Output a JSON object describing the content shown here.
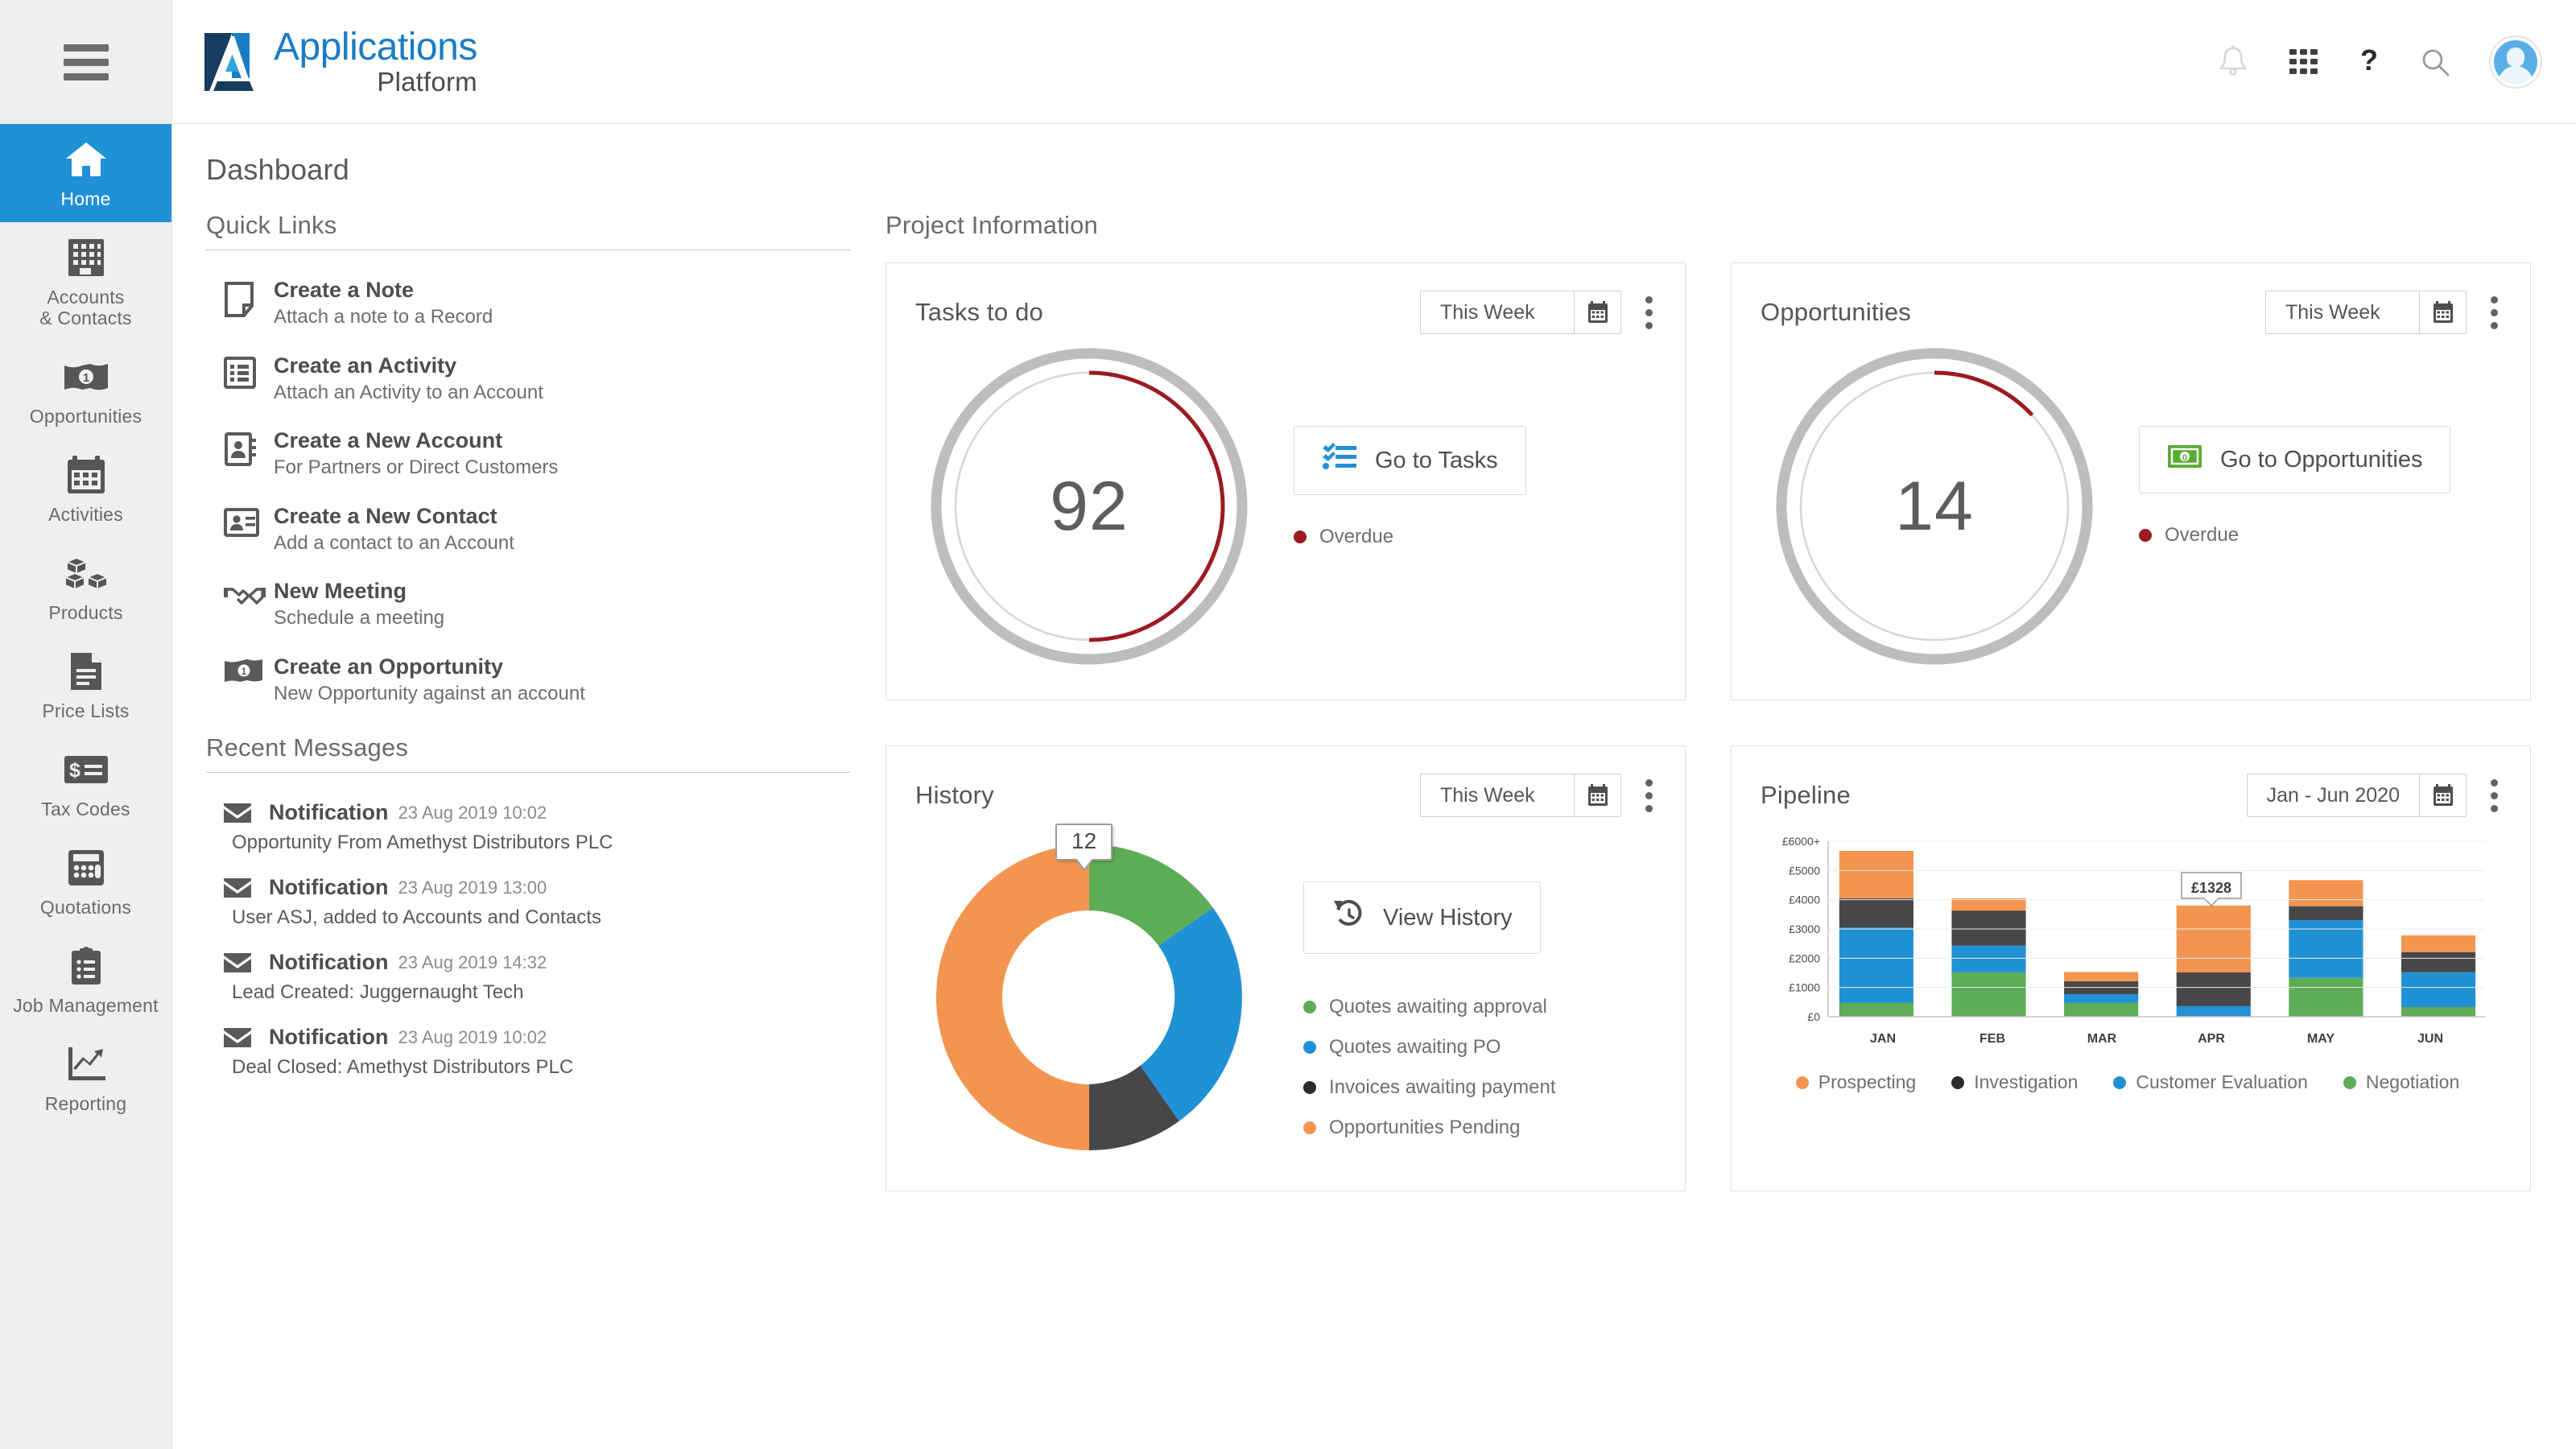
{
  "brand": {
    "line1": "Applications",
    "line2": "Platform",
    "logo_icon": "applications-platform-logo"
  },
  "header": {
    "icons": [
      {
        "name": "notifications-bell-icon",
        "label": "Notifications"
      },
      {
        "name": "app-grid-icon",
        "label": "Apps"
      },
      {
        "name": "help-question-icon",
        "label": "Help"
      },
      {
        "name": "search-icon",
        "label": "Search"
      }
    ],
    "avatar_label": "User profile"
  },
  "sidebar": {
    "menu_icon": "hamburger-menu-icon",
    "items": [
      {
        "label": "Home",
        "icon": "home-icon",
        "active": true
      },
      {
        "label": "Accounts\n& Contacts",
        "label_line1": "Accounts",
        "label_line2": "& Contacts",
        "icon": "building-icon",
        "active": false
      },
      {
        "label": "Opportunities",
        "icon": "banknote-icon",
        "active": false
      },
      {
        "label": "Activities",
        "icon": "calendar-icon",
        "active": false
      },
      {
        "label": "Products",
        "icon": "boxes-icon",
        "active": false
      },
      {
        "label": "Price Lists",
        "icon": "document-lines-icon",
        "active": false
      },
      {
        "label": "Tax Codes",
        "icon": "dollar-card-icon",
        "active": false
      },
      {
        "label": "Quotations",
        "icon": "calculator-icon",
        "active": false
      },
      {
        "label": "Job Management",
        "icon": "clipboard-list-icon",
        "active": false
      },
      {
        "label": "Reporting",
        "icon": "trend-chart-icon",
        "active": false
      }
    ]
  },
  "page": {
    "title": "Dashboard"
  },
  "quick_links": {
    "heading": "Quick Links",
    "items": [
      {
        "title": "Create a Note",
        "subtitle": "Attach a note to a Record",
        "icon": "note-page-icon"
      },
      {
        "title": "Create an Activity",
        "subtitle": "Attach an Activity to an Account",
        "icon": "list-box-icon"
      },
      {
        "title": "Create a New Account",
        "subtitle": "For Partners or Direct Customers",
        "icon": "address-book-icon"
      },
      {
        "title": "Create a New Contact",
        "subtitle": "Add a contact to an Account",
        "icon": "contact-card-icon"
      },
      {
        "title": "New Meeting",
        "subtitle": "Schedule a meeting",
        "icon": "handshake-icon"
      },
      {
        "title": "Create an Opportunity",
        "subtitle": "New Opportunity against an account",
        "icon": "banknote-icon"
      }
    ]
  },
  "recent_messages": {
    "heading": "Recent Messages",
    "items": [
      {
        "title": "Notification",
        "date": "23 Aug 2019 10:02",
        "body": "Opportunity From Amethyst Distributors PLC",
        "icon": "envelope-icon"
      },
      {
        "title": "Notification",
        "date": "23 Aug 2019 13:00",
        "body": "User ASJ, added to Accounts and Contacts",
        "icon": "envelope-icon"
      },
      {
        "title": "Notification",
        "date": "23 Aug 2019 14:32",
        "body": "Lead Created: Juggernaught Tech",
        "icon": "envelope-icon"
      },
      {
        "title": "Notification",
        "date": "23 Aug 2019 10:02",
        "body": "Deal Closed:  Amethyst Distributors PLC",
        "icon": "envelope-icon"
      }
    ]
  },
  "project_information": {
    "heading": "Project Information"
  },
  "cards": {
    "tasks": {
      "title": "Tasks to do",
      "range": "This Week",
      "calendar_icon": "calendar-icon",
      "kebab_icon": "more-vertical-icon",
      "value": "92",
      "button_label": "Go to Tasks",
      "button_icon": "task-list-icon",
      "legend": [
        {
          "label": "Overdue",
          "color": "#9B1B23"
        }
      ]
    },
    "opportunities": {
      "title": "Opportunities",
      "range": "This Week",
      "calendar_icon": "calendar-icon",
      "kebab_icon": "more-vertical-icon",
      "value": "14",
      "button_label": "Go to Opportunities",
      "button_icon": "money-green-icon",
      "legend": [
        {
          "label": "Overdue",
          "color": "#9B1B23"
        }
      ]
    },
    "history": {
      "title": "History",
      "range": "This Week",
      "calendar_icon": "calendar-icon",
      "kebab_icon": "more-vertical-icon",
      "tooltip": "12",
      "button_label": "View History",
      "button_icon": "history-clock-icon"
    },
    "pipeline": {
      "title": "Pipeline",
      "range": "Jan - Jun 2020",
      "calendar_icon": "calendar-icon",
      "kebab_icon": "more-vertical-icon",
      "tooltip": "£1328"
    }
  },
  "chart_data": [
    {
      "id": "tasks-gauge",
      "type": "pie",
      "title": "Tasks to do",
      "center_value": 92,
      "categories": [
        "Overdue",
        "Remaining"
      ],
      "values": [
        50,
        50
      ],
      "colors": [
        "#9B1B23",
        "#d9d9d9"
      ],
      "arc_degrees": 180,
      "legend": [
        "Overdue"
      ],
      "legend_position": "right"
    },
    {
      "id": "opportunities-gauge",
      "type": "pie",
      "title": "Opportunities",
      "center_value": 14,
      "categories": [
        "Overdue",
        "Remaining"
      ],
      "values": [
        13,
        87
      ],
      "colors": [
        "#9B1B23",
        "#d9d9d9"
      ],
      "arc_degrees": 47,
      "legend": [
        "Overdue"
      ],
      "legend_position": "right"
    },
    {
      "id": "history-donut",
      "type": "pie",
      "title": "History",
      "annotation": "12",
      "categories": [
        "Quotes awaiting approval",
        "Quotes awaiting PO",
        "Invoices awaiting payment",
        "Opportunities Pending"
      ],
      "values": [
        12,
        20,
        12,
        36
      ],
      "degrees": [
        54,
        90,
        54,
        162
      ],
      "colors": [
        "#5DAC56",
        "#2191D6",
        "#474749",
        "#F3954F"
      ],
      "legend": [
        "Quotes awaiting approval",
        "Quotes awaiting PO",
        "Invoices awaiting payment",
        "Opportunities Pending"
      ],
      "legend_position": "right"
    },
    {
      "id": "pipeline-bars",
      "type": "bar",
      "title": "Pipeline",
      "stacked": true,
      "annotation": "£1328",
      "annotation_category": "APR",
      "xlabel": "",
      "ylabel": "",
      "ylim": [
        0,
        6000
      ],
      "yticks": [
        0,
        1000,
        2000,
        3000,
        4000,
        5000,
        6000
      ],
      "ytick_labels": [
        "£0",
        "£1000",
        "£2000",
        "£3000",
        "£4000",
        "£5000",
        "£6000+"
      ],
      "grid": true,
      "categories": [
        "JAN",
        "FEB",
        "MAR",
        "APR",
        "MAY",
        "JUN"
      ],
      "series": [
        {
          "name": "Negotiation",
          "color": "#5DAC56",
          "values": [
            470,
            1520,
            470,
            0,
            1330,
            330
          ]
        },
        {
          "name": "Customer Evaluation",
          "color": "#2191D6",
          "values": [
            2580,
            910,
            300,
            360,
            1970,
            1190
          ]
        },
        {
          "name": "Investigation",
          "color": "#474749",
          "values": [
            1000,
            1200,
            440,
            1160,
            480,
            690
          ]
        },
        {
          "name": "Prospecting",
          "color": "#F3954F",
          "values": [
            1620,
            420,
            320,
            2280,
            890,
            570
          ]
        }
      ],
      "legend": [
        "Prospecting",
        "Investigation",
        "Customer Evaluation",
        "Negotiation"
      ],
      "legend_position": "bottom"
    }
  ],
  "colors": {
    "accent_blue": "#2191d6",
    "brand_blue": "#1a7cc4",
    "brand_navy": "#173c5e",
    "orange": "#F3954F",
    "green": "#5DAC56",
    "dark": "#474749",
    "red": "#9B1B23",
    "rail_bg": "#efefef"
  }
}
